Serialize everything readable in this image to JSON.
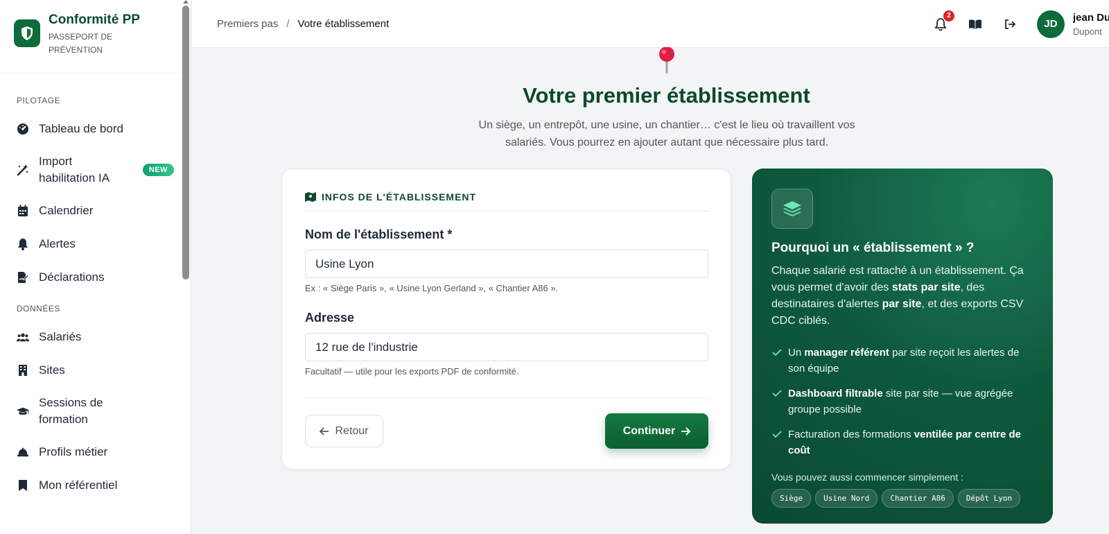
{
  "brand": {
    "title": "Conformité PP",
    "subtitle": "PASSEPORT DE PRÉVENTION"
  },
  "sidebar": {
    "sections": [
      {
        "label": "PILOTAGE",
        "items": [
          {
            "label": "Tableau de bord",
            "icon": "gauge-icon"
          },
          {
            "label": "Import habilitation IA",
            "icon": "magic-wand-icon",
            "badge": "NEW"
          },
          {
            "label": "Calendrier",
            "icon": "calendar-icon"
          },
          {
            "label": "Alertes",
            "icon": "bell-icon"
          },
          {
            "label": "Déclarations",
            "icon": "file-signature-icon"
          }
        ]
      },
      {
        "label": "DONNÉES",
        "items": [
          {
            "label": "Salariés",
            "icon": "users-icon"
          },
          {
            "label": "Sites",
            "icon": "building-icon"
          },
          {
            "label": "Sessions de formation",
            "icon": "graduation-cap-icon"
          },
          {
            "label": "Profils métier",
            "icon": "hard-hat-icon"
          },
          {
            "label": "Mon référentiel",
            "icon": "bookmark-icon"
          }
        ]
      }
    ]
  },
  "header": {
    "breadcrumb": {
      "parent": "Premiers pas",
      "separator": "/",
      "current": "Votre établissement"
    },
    "notification_count": "2",
    "user": {
      "initials": "JD",
      "first_name": "jean Du",
      "last_name": "Dupont"
    }
  },
  "main": {
    "title": "Votre premier établissement",
    "subtitle": "Un siège, un entrepôt, une usine, un chantier… c'est le lieu où travaillent vos salariés. Vous pourrez en ajouter autant que nécessaire plus tard."
  },
  "form": {
    "section_title": "INFOS DE L'ÉTABLISSEMENT",
    "name_label": "Nom de l'établissement *",
    "name_value": "Usine Lyon",
    "name_help": "Ex : « Siège Paris », « Usine Lyon Gerland », « Chantier A86 ».",
    "address_label": "Adresse",
    "address_value": "12 rue de l'industrie",
    "address_help": "Facultatif — utile pour les exports PDF de conformité.",
    "back_label": "Retour",
    "continue_label": "Continuer"
  },
  "info": {
    "title": "Pourquoi un « établissement » ?",
    "body_parts": [
      "Chaque salarié est rattaché à un établissement. Ça vous permet d'avoir des ",
      "stats par site",
      ", des destinataires d'alertes ",
      "par site",
      ", et des exports CSV CDC ciblés."
    ],
    "checks": [
      {
        "pre": "Un ",
        "bold": "manager référent",
        "post": " par site reçoit les alertes de son équipe"
      },
      {
        "pre": "",
        "bold": "Dashboard filtrable",
        "post": " site par site — vue agrégée groupe possible"
      },
      {
        "pre": "Facturation des formations ",
        "bold": "ventilée par centre de coût",
        "post": ""
      }
    ],
    "footer": "Vous pouvez aussi commencer simplement :",
    "chips": [
      "Siège",
      "Usine Nord",
      "Chantier A86",
      "Dépôt Lyon"
    ]
  },
  "colors": {
    "brand_green": "#0f6b3a",
    "title_green": "#0c4a2c",
    "notification_red": "#e02424",
    "info_card_bg": "#0e5a3d"
  }
}
